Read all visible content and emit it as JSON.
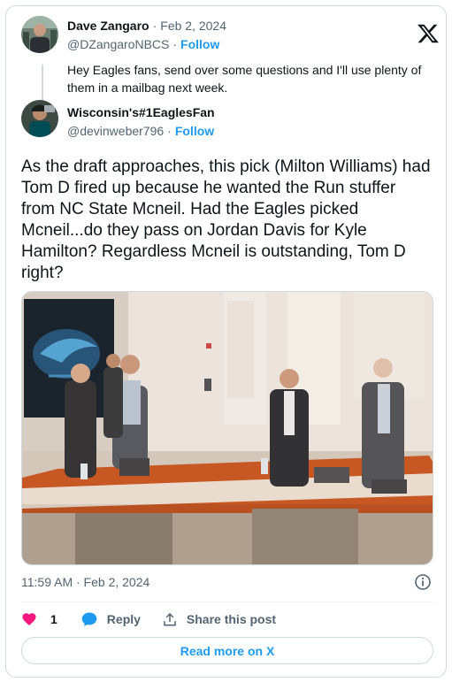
{
  "quoted": {
    "name": "Dave Zangaro",
    "date": "Feb 2, 2024",
    "handle": "@DZangaroNBCS",
    "follow_label": "Follow",
    "text": "Hey Eagles fans, send over some questions and I'll use plenty of them in a mailbag next week."
  },
  "reply": {
    "name": "Wisconsin's#1EaglesFan",
    "handle": "@devinweber796",
    "follow_label": "Follow",
    "text": "As the draft approaches, this pick (Milton Williams) had Tom D fired up because he wanted the Run stuffer from NC State Mcneil. Had the Eagles picked Mcneil...do they pass on Jordan Davis for Kyle Hamilton? Regardless Mcneil is outstanding, Tom D right?"
  },
  "timestamp": "11:59 AM · Feb 2, 2024",
  "actions": {
    "like_count": "1",
    "reply_label": "Reply",
    "share_label": "Share this post"
  },
  "read_more_label": "Read more on X",
  "colors": {
    "accent": "#1d9bf0",
    "like": "#f91880",
    "muted": "#536471",
    "border": "#cfd9de"
  },
  "icons": [
    "x-logo-icon",
    "heart-icon",
    "reply-bubble-icon",
    "share-icon",
    "info-icon"
  ]
}
